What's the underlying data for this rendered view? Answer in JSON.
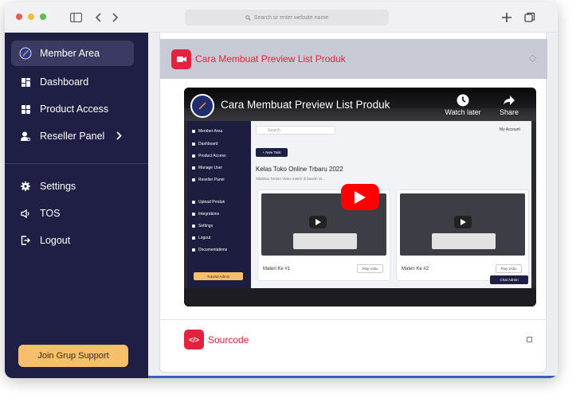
{
  "browser": {
    "url_placeholder": "Search or enter website name"
  },
  "sidebar": {
    "items": [
      {
        "label": "Member Area",
        "icon": "member-logo-icon"
      },
      {
        "label": "Dashboard",
        "icon": "dashboard-icon"
      },
      {
        "label": "Product Access",
        "icon": "product-access-icon"
      },
      {
        "label": "Reseller Panel",
        "icon": "reseller-icon"
      },
      {
        "label": "Settings",
        "icon": "gear-icon"
      },
      {
        "label": "TOS",
        "icon": "speaker-icon"
      },
      {
        "label": "Logout",
        "icon": "logout-icon"
      }
    ],
    "join_button": "Join Grup Support"
  },
  "main": {
    "section_title": "Cara Membuat Preview List Produk",
    "video": {
      "title": "Cara Membuat Preview List Produk",
      "watch_later": "Watch later",
      "share": "Share",
      "inner": {
        "nav": [
          "Member Area",
          "Dashboard",
          "Product Access",
          "Manage User",
          "Reseller Panel",
          "Upload Produk",
          "Integrations",
          "Settings",
          "Logout",
          "Documentations"
        ],
        "tutorial_btn": "Tutorial Admin",
        "search": "Search",
        "account": "My Account",
        "new_task": "+ New Task",
        "heading": "Kelas Toko Online Trbaru 2022",
        "subheading": "Silahkan Tonton Video materi di bawah ini...",
        "cards": [
          {
            "title": "Materi Ke #1",
            "button": "Play Vidio"
          },
          {
            "title": "Materi Ke #2",
            "button": "Play Vidio"
          }
        ],
        "chat": "Chat Admin"
      }
    },
    "sourcecode_title": "Sourcode"
  }
}
